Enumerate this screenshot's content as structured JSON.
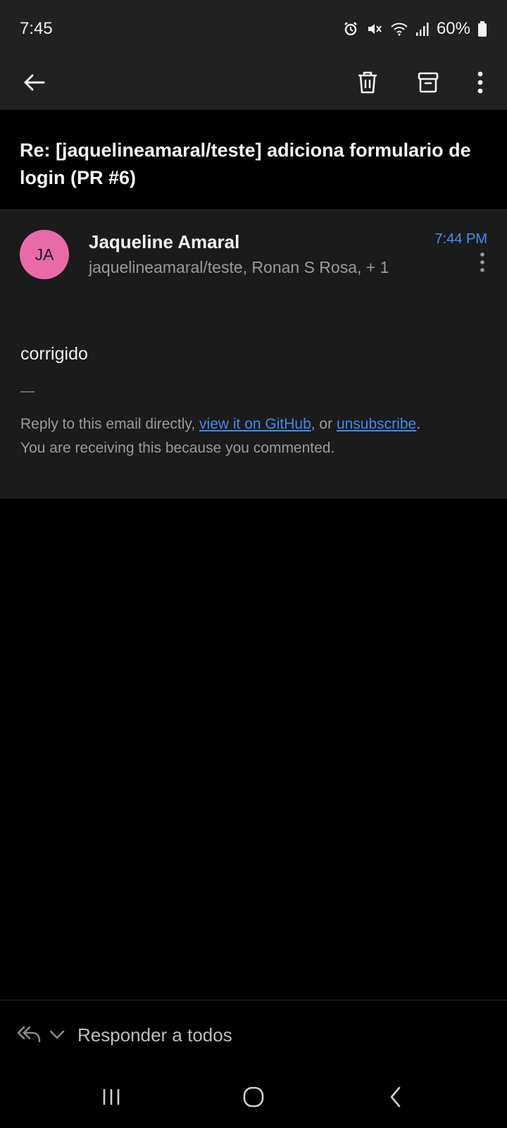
{
  "status_bar": {
    "time": "7:45",
    "battery": "60%",
    "icons": [
      "alarm-icon",
      "mute-icon",
      "wifi-icon",
      "signal-icon",
      "battery-icon"
    ]
  },
  "toolbar": {
    "icons": [
      "back-arrow-icon",
      "trash-icon",
      "archive-icon",
      "more-vertical-icon"
    ]
  },
  "email": {
    "subject": "Re: [jaqueline­amaral/teste] adiciona formulario de login (PR #6)",
    "sender_initials": "JA",
    "sender_name": "Jaqueline Amaral",
    "recipients": "jaquelineamaral/teste, Ronan S Rosa, + 1",
    "time": "7:44 PM",
    "body": "corrigido",
    "signature_dash": "—",
    "footer": {
      "prefix": "Reply to this email directly, ",
      "link_github": "view it on GitHub",
      "middle": ", or ",
      "link_unsubscribe": "unsubscribe",
      "suffix": ".",
      "reason": "You are receiving this because you commented."
    }
  },
  "reply_bar": {
    "label": "Responder a todos"
  },
  "colors": {
    "accent": "#3d8ff0",
    "avatar": "#ea6aa8",
    "header_bg": "#212121",
    "message_bg": "#1b1b1b"
  }
}
